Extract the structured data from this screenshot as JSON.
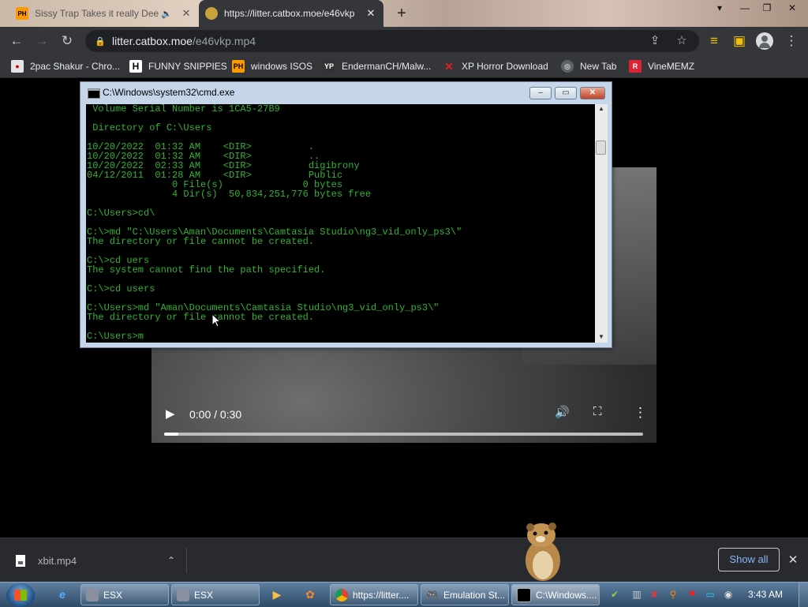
{
  "browser": {
    "tabs": [
      {
        "title": "Sissy Trap Takes it really Dee",
        "favicon": "PH",
        "audio": true,
        "active": false
      },
      {
        "title": "https://litter.catbox.moe/e46vkp",
        "favicon": "catbox",
        "active": true
      }
    ],
    "new_tab_symbol": "+",
    "address": {
      "host": "litter.catbox.moe",
      "path": "/e46vkp.mp4"
    },
    "bookmarks": [
      {
        "label": "2pac Shakur - Chro...",
        "icon": "PH-red"
      },
      {
        "label": "FUNNY SNIPPIES",
        "icon": "H"
      },
      {
        "label": "windows ISOS",
        "icon": "PH"
      },
      {
        "label": "EndermanCH/Malw...",
        "icon": "YP"
      },
      {
        "label": "XP Horror Download",
        "icon": "X"
      },
      {
        "label": "New Tab",
        "icon": "globe"
      },
      {
        "label": "VineMEMZ",
        "icon": "R"
      }
    ]
  },
  "video": {
    "time": "0:00 / 0:30",
    "progress_fraction": 0.03
  },
  "cmd": {
    "title": "C:\\Windows\\system32\\cmd.exe",
    "lines": [
      " Volume Serial Number is 1CA5-27B9",
      "",
      " Directory of C:\\Users",
      "",
      "10/20/2022  01:32 AM    <DIR>          .",
      "10/20/2022  01:32 AM    <DIR>          ..",
      "10/20/2022  02:33 AM    <DIR>          digibrony",
      "04/12/2011  01:28 AM    <DIR>          Public",
      "               0 File(s)              0 bytes",
      "               4 Dir(s)  50,834,251,776 bytes free",
      "",
      "C:\\Users>cd\\",
      "",
      "C:\\>md \"C:\\Users\\Aman\\Documents\\Camtasia Studio\\ng3_vid_only_ps3\\\"",
      "The directory or file cannot be created.",
      "",
      "C:\\>cd uers",
      "The system cannot find the path specified.",
      "",
      "C:\\>cd users",
      "",
      "C:\\Users>md \"Aman\\Documents\\Camtasia Studio\\ng3_vid_only_ps3\\\"",
      "The directory or file cannot be created.",
      "",
      "C:\\Users>m"
    ],
    "text_color": "#2fb52f"
  },
  "downloads": {
    "file": "xbit.mp4",
    "show_all": "Show all"
  },
  "taskbar": {
    "items": [
      {
        "label": "ESX",
        "icon": "esx"
      },
      {
        "label": "ESX",
        "icon": "esx"
      },
      {
        "label": "https://litter....",
        "icon": "chrome"
      },
      {
        "label": "Emulation St...",
        "icon": "gamepad"
      },
      {
        "label": "C:\\Windows....",
        "icon": "cmd",
        "active": true
      }
    ],
    "clock": "3:43 AM"
  }
}
